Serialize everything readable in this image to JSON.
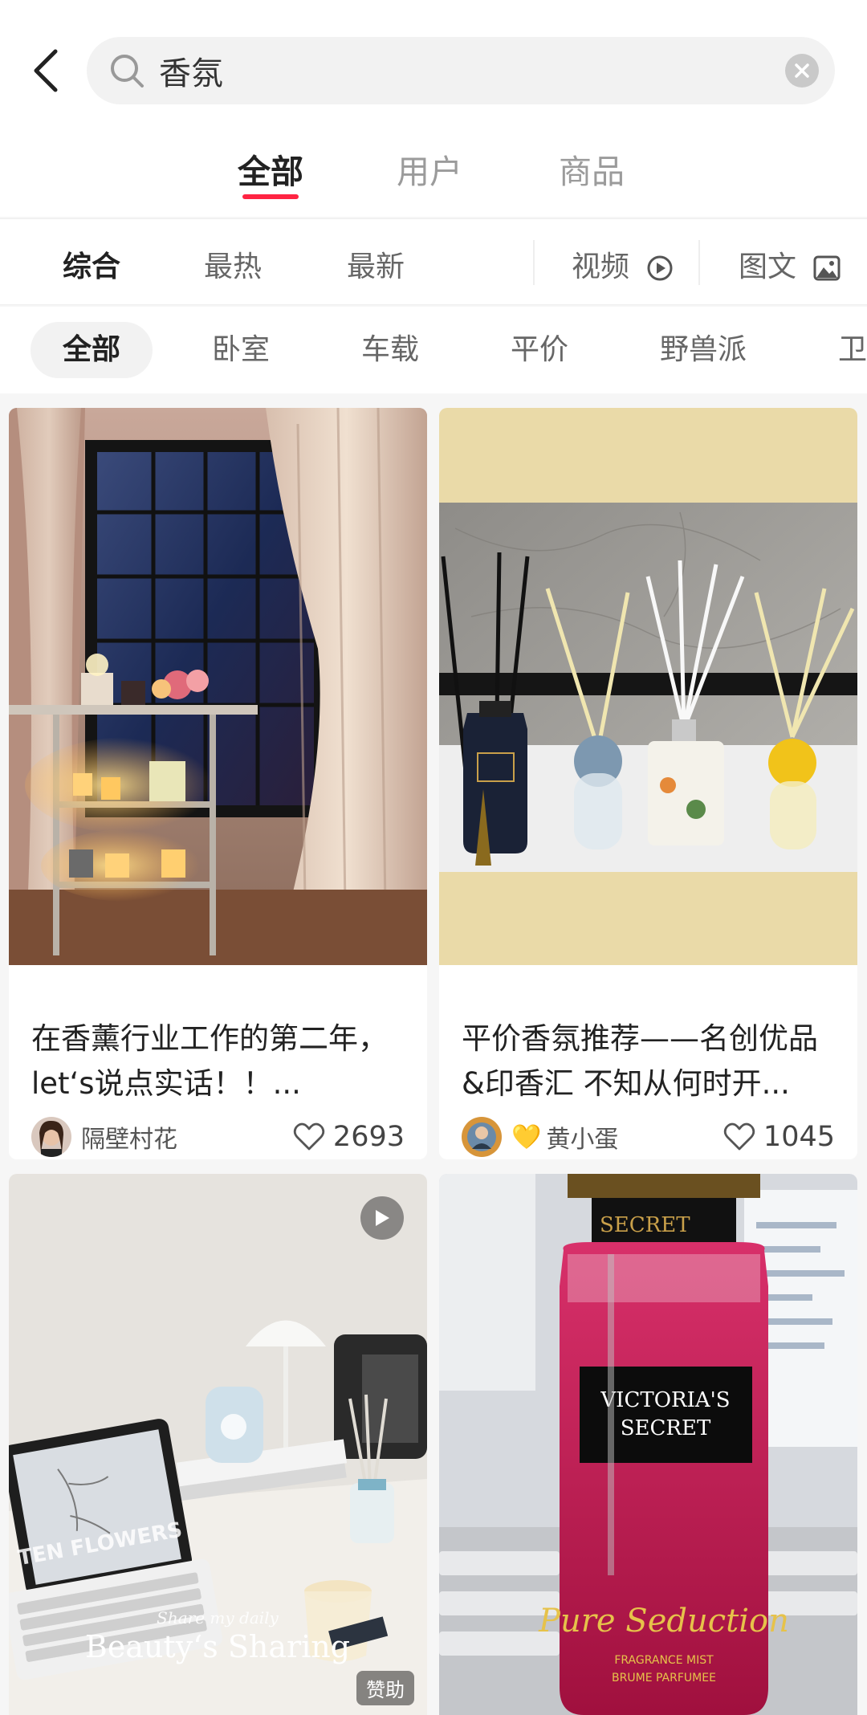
{
  "search": {
    "query": "香氛"
  },
  "top_tabs": [
    {
      "label": "全部",
      "active": true
    },
    {
      "label": "用户",
      "active": false
    },
    {
      "label": "商品",
      "active": false
    }
  ],
  "sort": {
    "comprehensive": "综合",
    "hottest": "最热",
    "newest": "最新",
    "video": "视频",
    "image_text": "图文"
  },
  "chips": [
    "全部",
    "卧室",
    "车载",
    "平价",
    "野兽派",
    "卫"
  ],
  "feed": [
    {
      "title": "在香薰行业工作的第二年，let‘s说点实话！！...",
      "author": "隔壁村花",
      "likes": "2693"
    },
    {
      "title": "平价香氛推荐——名创优品&印香汇 不知从何时开...",
      "author_emoji": "💛",
      "author": "黄小蛋",
      "likes": "1045"
    },
    {
      "overlay_script": "Share my daily",
      "overlay_title": "Beauty‘s Sharing",
      "tablet_text": "TEN FLOWERS",
      "badge": "赞助"
    },
    {
      "brand_top": "SECRET",
      "brand_label_1": "VICTORIA'S",
      "brand_label_2": "SECRET",
      "product_script": "Pure Seduction",
      "product_sub_1": "FRAGRANCE MIST",
      "product_sub_2": "BRUME PARFUMEE"
    }
  ],
  "colors": {
    "accent": "#ff2442",
    "background": "#f6f6f6"
  }
}
